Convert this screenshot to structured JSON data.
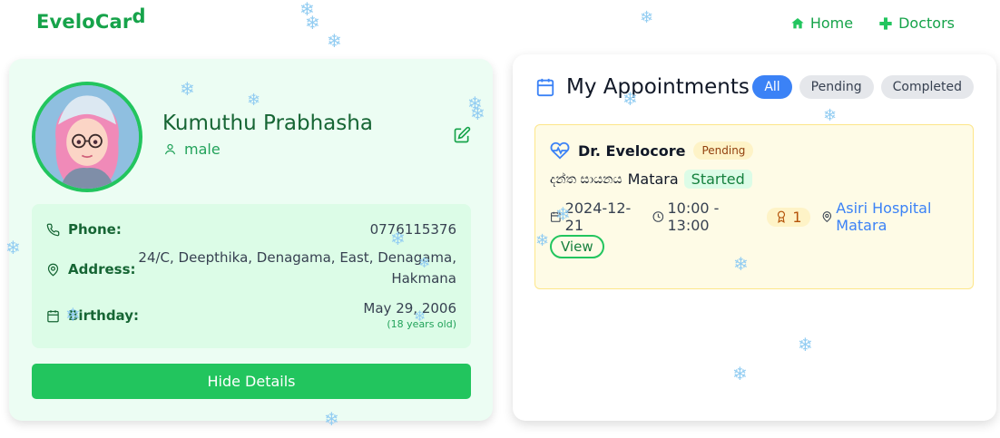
{
  "brand": {
    "main": "EveloCar",
    "sup": "d"
  },
  "nav": {
    "home": "Home",
    "doctors": "Doctors"
  },
  "profile": {
    "name": "Kumuthu Prabhasha",
    "gender": "male",
    "phone_label": "Phone:",
    "phone": "0776115376",
    "address_label": "Address:",
    "address_line1": "24/C, Deepthika, Denagama, East, Denagama,",
    "address_line2": "Hakmana",
    "birthday_label": "Birthday:",
    "birthday": "May 29, 2006",
    "age": "(18 years old)",
    "hide_button": "Hide Details"
  },
  "appointments": {
    "title": "My Appointments",
    "filters": [
      "All",
      "Pending",
      "Completed"
    ],
    "active_filter": "All",
    "items": [
      {
        "doctor": "Dr. Evelocore",
        "status": "Pending",
        "specialty_si": "දන්ත සායනය",
        "location_city": "Matara",
        "session_state": "Started",
        "date": "2024-12-21",
        "time": "10:00 - 13:00",
        "queue": "1",
        "hospital": "Asiri Hospital Matara",
        "view_label": "View"
      }
    ]
  },
  "icons": {
    "home": "home-icon",
    "doctors": "plus-icon",
    "user": "user-icon",
    "edit": "edit-icon",
    "phone": "phone-icon",
    "address": "map-pin-icon",
    "birthday": "calendar-icon",
    "calendar": "calendar-icon",
    "heart": "heart-pulse-icon",
    "clock": "clock-icon",
    "award": "award-icon",
    "location": "map-pin-icon"
  },
  "colors": {
    "brand_green": "#16a34a",
    "button_green": "#22c55e",
    "accent_blue": "#3b82f6",
    "pending_bg": "#fef3c7",
    "card_bg": "#ecfdf3"
  }
}
